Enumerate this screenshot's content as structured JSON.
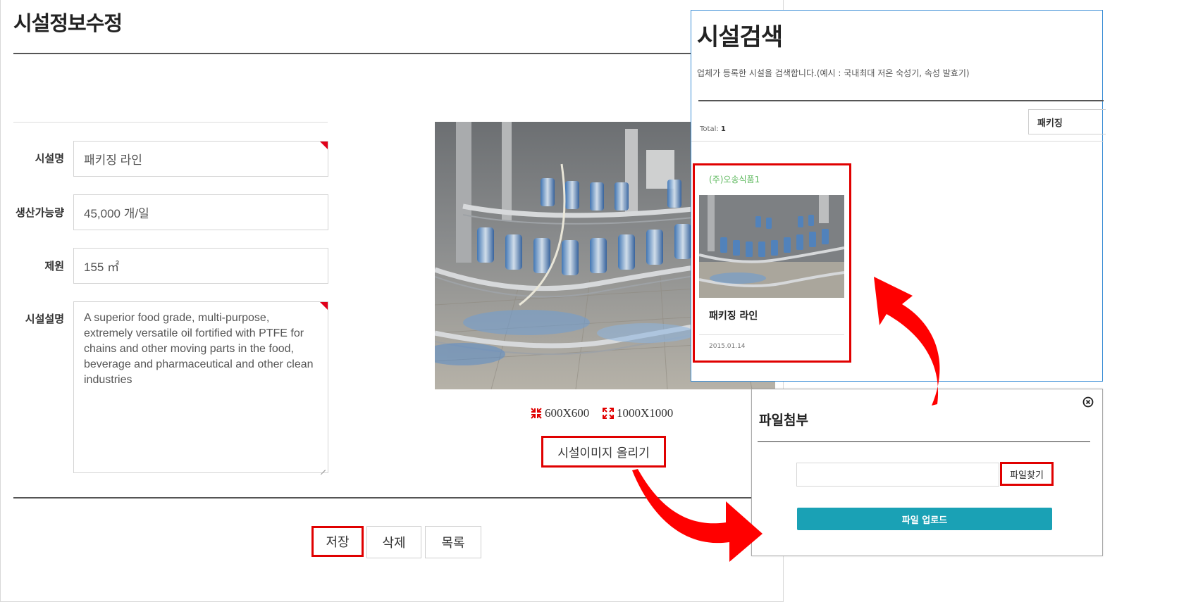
{
  "edit_form": {
    "title": "시설정보수정",
    "fields": {
      "name": {
        "label": "시설명",
        "value": "패키징 라인"
      },
      "capacity": {
        "label": "생산가능량",
        "value": "45,000 개/일"
      },
      "spec": {
        "label": "제원",
        "value": "155 ㎡"
      },
      "description": {
        "label": "시설설명",
        "value": "A superior food grade, multi-purpose, extremely versatile oil fortified with PTFE for chains and other moving parts in the food, beverage and pharmaceutical and other clean industries"
      }
    },
    "image_sizes": [
      "600X600",
      "1000X1000"
    ],
    "upload_image_button": "시설이미지 올리기",
    "buttons": {
      "save": "저장",
      "delete": "삭제",
      "list": "목록"
    }
  },
  "search_panel": {
    "title": "시설검색",
    "description": "업체가 등록한 시설을 검색합니다.(예시 : 국내최대 저온 숙성기, 속성 발효기)",
    "total_label": "Total:",
    "total_count": "1",
    "filter_value": "패키징",
    "result": {
      "company": "(주)오송식품1",
      "name": "패키징 라인",
      "date": "2015.01.14"
    }
  },
  "upload_dialog": {
    "title": "파일첨부",
    "find_button": "파일찾기",
    "upload_button": "파일 업로드"
  },
  "colors": {
    "highlight": "#e00000",
    "upload_button": "#1aa1b5",
    "company_text": "#5cb85c",
    "panel_border": "#3d8fd6"
  }
}
